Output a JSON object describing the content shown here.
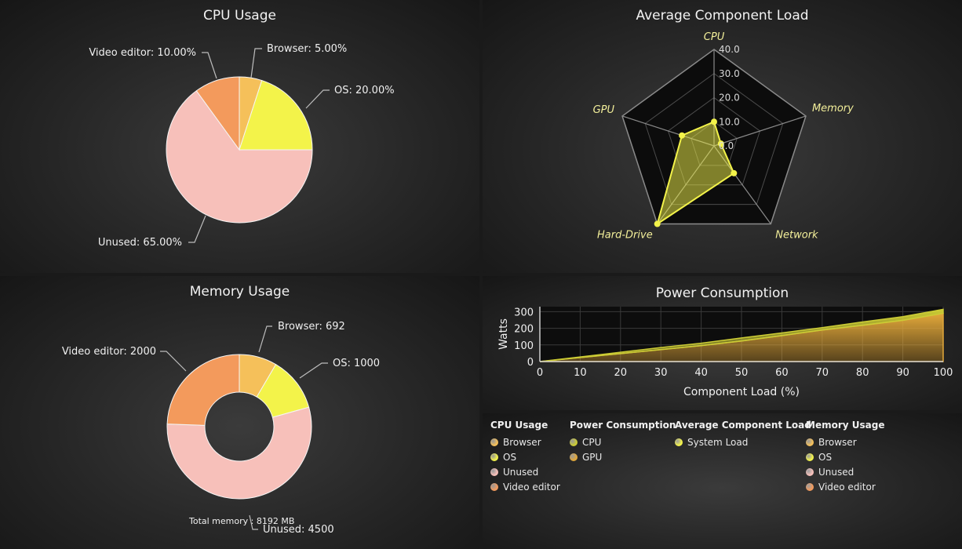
{
  "colors": {
    "browser": "#f5c05a",
    "os": "#f3f34a",
    "unused": "#f7c0ba",
    "video_editor": "#f39a5c",
    "radar": "#f3f34a",
    "cpu_power": "#cccc35",
    "gpu_power": "#e2a83a"
  },
  "chart_data": [
    {
      "type": "pie",
      "title": "CPU Usage",
      "slices": [
        {
          "name": "Browser",
          "value": 5,
          "label": "Browser: 5.00%"
        },
        {
          "name": "OS",
          "value": 20,
          "label": "OS: 20.00%"
        },
        {
          "name": "Unused",
          "value": 65,
          "label": "Unused: 65.00%"
        },
        {
          "name": "Video editor",
          "value": 10,
          "label": "Video editor: 10.00%"
        }
      ]
    },
    {
      "type": "radar",
      "title": "Average Component Load",
      "axes": [
        "CPU",
        "Memory",
        "Network",
        "Hard-Drive",
        "GPU"
      ],
      "ticks": [
        "0.0",
        "10.0",
        "20.0",
        "30.0",
        "40.0"
      ],
      "range": [
        0,
        40
      ],
      "series": [
        {
          "name": "System Load",
          "values": [
            10,
            3,
            14,
            40,
            14
          ]
        }
      ]
    },
    {
      "type": "pie",
      "title": "Memory Usage",
      "subtitle": "Total memory : 8192 MB",
      "donut": true,
      "slices": [
        {
          "name": "Browser",
          "value": 692,
          "label": "Browser: 692"
        },
        {
          "name": "OS",
          "value": 1000,
          "label": "OS: 1000"
        },
        {
          "name": "Unused",
          "value": 4500,
          "label": "Unused: 4500"
        },
        {
          "name": "Video editor",
          "value": 2000,
          "label": "Video editor: 2000"
        }
      ]
    },
    {
      "type": "area",
      "title": "Power Consumption",
      "xlabel": "Component Load (%)",
      "ylabel": "Watts",
      "xlim": [
        0,
        100
      ],
      "ylim": [
        0,
        330
      ],
      "xticks": [
        "0",
        "10",
        "20",
        "30",
        "40",
        "50",
        "60",
        "70",
        "80",
        "90",
        "100"
      ],
      "yticks": [
        "0",
        "100",
        "200",
        "300"
      ],
      "grid": true,
      "stacked": true,
      "x": [
        0,
        10,
        20,
        30,
        40,
        50,
        60,
        70,
        80,
        90,
        100
      ],
      "series": [
        {
          "name": "GPU",
          "values": [
            0,
            24,
            48,
            72,
            96,
            124,
            156,
            190,
            218,
            248,
            290
          ]
        },
        {
          "name": "CPU",
          "values": [
            0,
            4,
            8,
            12,
            14,
            18,
            16,
            14,
            20,
            22,
            24
          ]
        }
      ]
    }
  ],
  "legend": [
    {
      "title": "CPU Usage",
      "items": [
        [
          "Browser",
          "browser"
        ],
        [
          "OS",
          "os"
        ],
        [
          "Unused",
          "unused"
        ],
        [
          "Video editor",
          "video_editor"
        ]
      ]
    },
    {
      "title": "Power Consumption",
      "items": [
        [
          "CPU",
          "cpu_power"
        ],
        [
          "GPU",
          "gpu_power"
        ]
      ]
    },
    {
      "title": "Average Component Load",
      "items": [
        [
          "System Load",
          "radar"
        ]
      ]
    },
    {
      "title": "Memory Usage",
      "items": [
        [
          "Browser",
          "browser"
        ],
        [
          "OS",
          "os"
        ],
        [
          "Unused",
          "unused"
        ],
        [
          "Video editor",
          "video_editor"
        ]
      ]
    }
  ]
}
